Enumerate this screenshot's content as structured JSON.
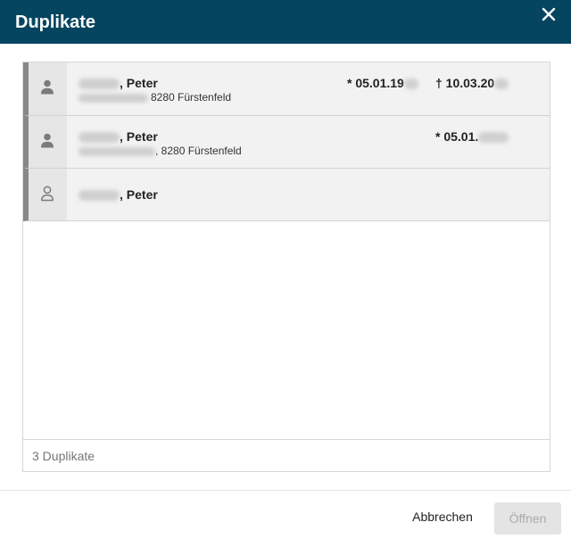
{
  "dialog": {
    "title": "Duplikate",
    "close_icon": "close-icon"
  },
  "rows": [
    {
      "icon": "person-filled-icon",
      "name_suffix": ", Peter",
      "address_suffix": "8280 Fürstenfeld",
      "born": "* 05.01.19",
      "died": "† 10.03.20"
    },
    {
      "icon": "person-filled-icon",
      "name_suffix": ", Peter",
      "address_suffix": ", 8280 Fürstenfeld",
      "born": "* 05.01."
    },
    {
      "icon": "person-outline-icon",
      "name_suffix": ", Peter"
    }
  ],
  "summary": {
    "count_label": "3 Duplikate"
  },
  "actions": {
    "cancel_label": "Abbrechen",
    "open_label": "Öffnen"
  },
  "colors": {
    "header_bg": "#064560",
    "row_accent": "#888888"
  }
}
